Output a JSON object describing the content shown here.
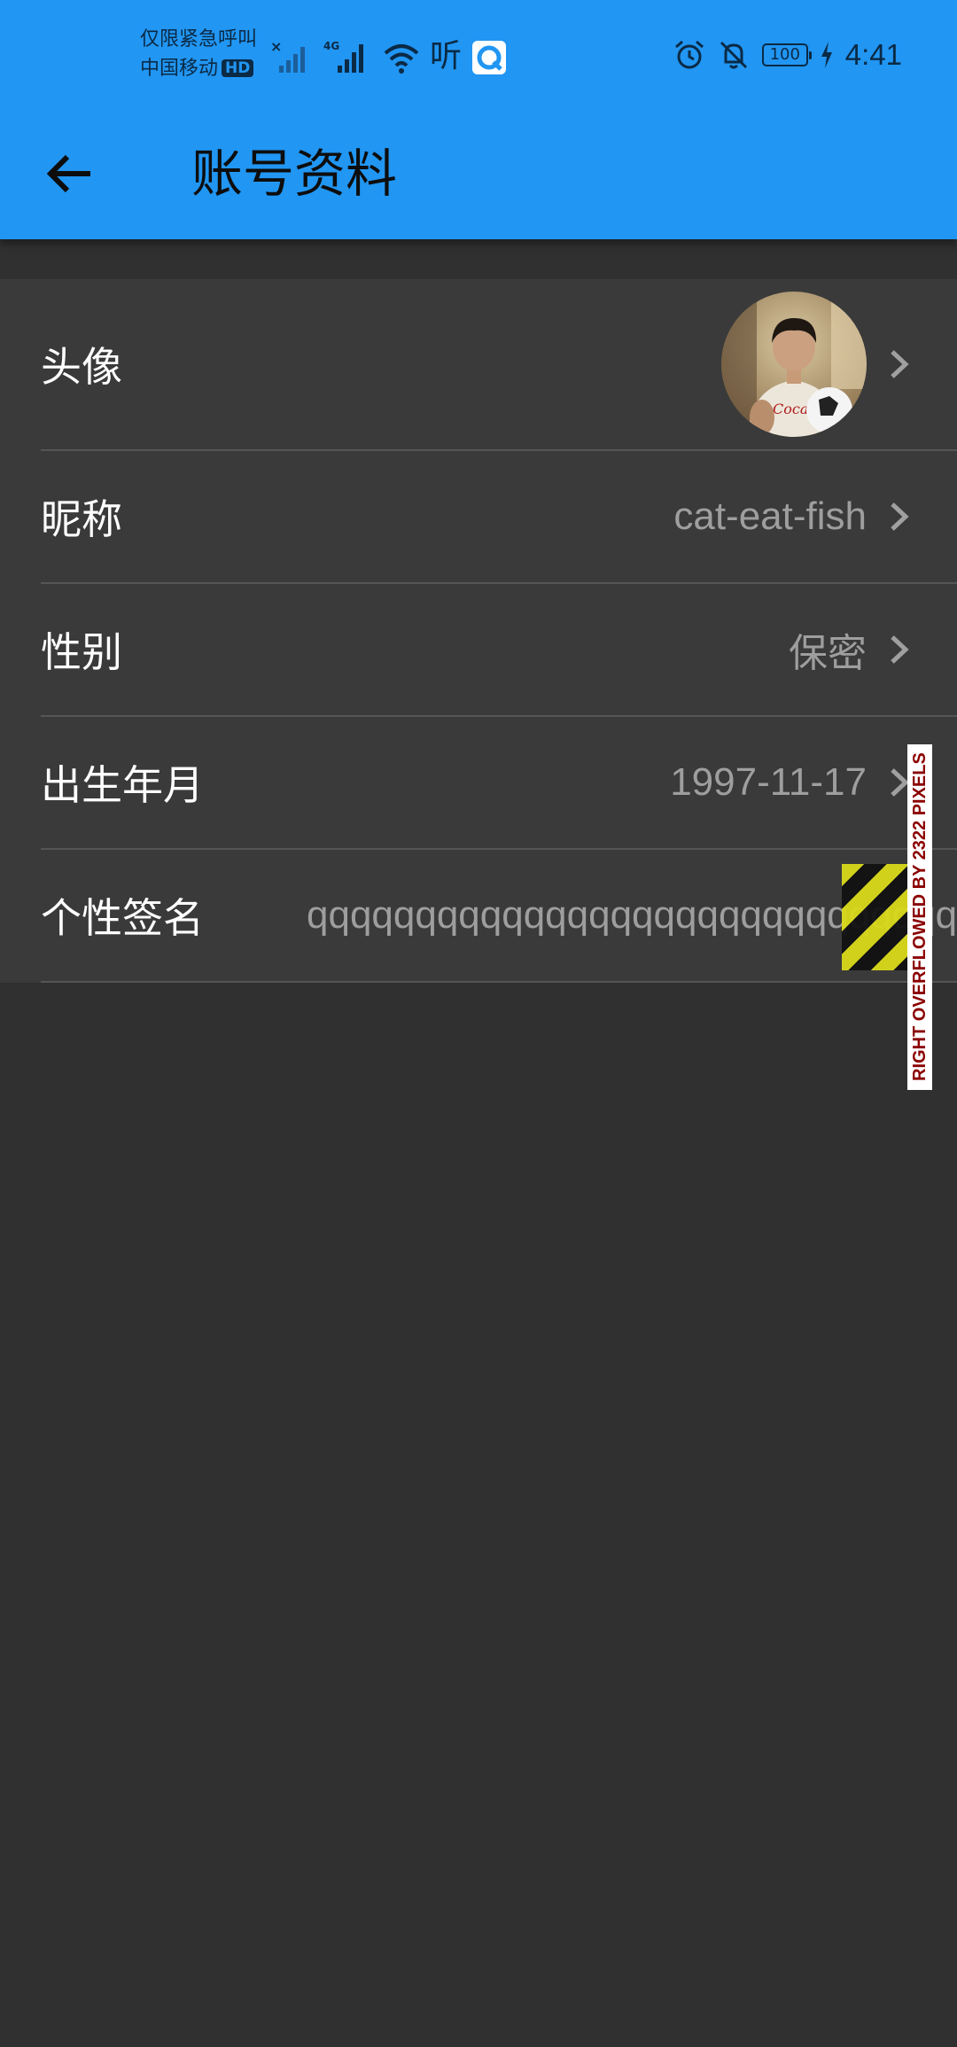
{
  "status_bar": {
    "carrier_line1": "仅限紧急呼叫",
    "carrier_line2": "中国移动",
    "hd_badge": "HD",
    "network_label": "4G",
    "listen_glyph": "听",
    "battery_level": "100",
    "time": "4:41",
    "icons": [
      "sim-x-icon",
      "signal-icon",
      "wifi-icon",
      "app-icon",
      "alarm-icon",
      "mute-bell-icon",
      "battery-icon",
      "charging-icon"
    ]
  },
  "app_bar": {
    "back_icon": "arrow-left-icon",
    "title": "账号资料",
    "color": "#2196F3"
  },
  "profile": {
    "avatar": {
      "label": "头像"
    },
    "nickname": {
      "label": "昵称",
      "value": "cat-eat-fish"
    },
    "gender": {
      "label": "性别",
      "value": "保密"
    },
    "birth": {
      "label": "出生年月",
      "value": "1997-11-17"
    },
    "signature": {
      "label": "个性签名",
      "value": "qqqqqqqqqqqqqqqqqqqqqqqqqqqqqqqqqq"
    }
  },
  "overflow_warning": "RIGHT OVERFLOWED BY 2322 PIXELS"
}
